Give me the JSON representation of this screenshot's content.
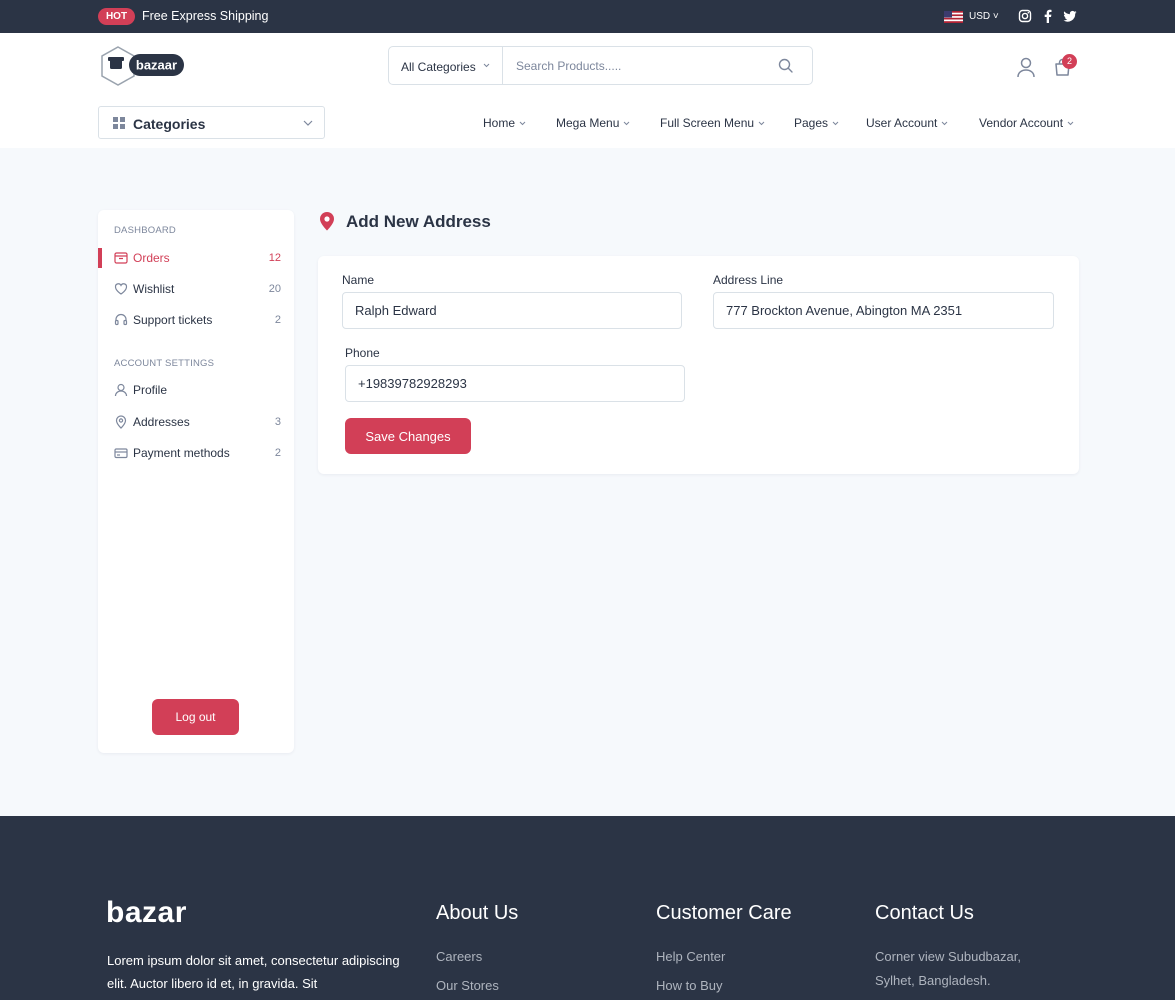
{
  "topbar": {
    "hot_badge": "HOT",
    "promo_text": "Free Express Shipping",
    "currency": "USD",
    "social_icons": [
      "instagram-icon",
      "facebook-icon",
      "twitter-icon"
    ]
  },
  "header": {
    "logo_text": "bazaar",
    "search": {
      "category": "All Categories",
      "placeholder": "Search Products....."
    },
    "cart_count": "2"
  },
  "nav": {
    "categories_label": "Categories",
    "items": [
      "Home",
      "Mega Menu",
      "Full Screen Menu",
      "Pages",
      "User Account",
      "Vendor Account"
    ]
  },
  "sidebar": {
    "dashboard_title": "DASHBOARD",
    "dashboard_items": [
      {
        "label": "Orders",
        "count": "12",
        "icon": "orders-icon",
        "active": true
      },
      {
        "label": "Wishlist",
        "count": "20",
        "icon": "heart-icon"
      },
      {
        "label": "Support tickets",
        "count": "2",
        "icon": "headset-icon"
      }
    ],
    "account_title": "ACCOUNT SETTINGS",
    "account_items": [
      {
        "label": "Profile",
        "count": "",
        "icon": "user-icon"
      },
      {
        "label": "Addresses",
        "count": "3",
        "icon": "location-icon"
      },
      {
        "label": "Payment methods",
        "count": "2",
        "icon": "credit-card-icon"
      }
    ],
    "logout_label": "Log out"
  },
  "main": {
    "title": "Add New Address",
    "form": {
      "name_label": "Name",
      "name_value": "Ralph Edward",
      "address_label": "Address Line",
      "address_value": "777 Brockton Avenue, Abington MA 2351",
      "phone_label": "Phone",
      "phone_value": "+19839782928293",
      "save_label": "Save Changes"
    }
  },
  "footer": {
    "logo_text": "bazar",
    "description": "Lorem ipsum dolor sit amet, consectetur adipiscing elit. Auctor libero id et, in gravida. Sit",
    "columns": [
      {
        "heading": "About Us",
        "links": [
          "Careers",
          "Our Stores"
        ]
      },
      {
        "heading": "Customer Care",
        "links": [
          "Help Center",
          "How to Buy"
        ]
      },
      {
        "heading": "Contact Us",
        "links": [
          "Corner view Subudbazar,",
          "Sylhet, Bangladesh."
        ]
      }
    ]
  },
  "colors": {
    "brand": "#d23f57",
    "dark": "#2b3445",
    "background": "#f6f9fc"
  }
}
